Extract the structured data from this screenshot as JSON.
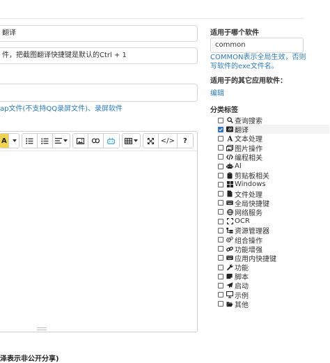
{
  "form": {
    "field1_value": "翻译",
    "field2_value": "件，把截图翻译快捷键是默认的Ctrl + 1",
    "field3_value": "",
    "links_prefix": "ap文件(不支持QQ录屏文件)、",
    "links_record": "录屏软件",
    "bottom_note": "泽表示非公开分享)"
  },
  "toolbar": {
    "font_color_label": "A",
    "source_label": "</>",
    "help_label": "?"
  },
  "sidebar": {
    "app_label": "适用于哪个软件",
    "app_value": "common",
    "app_help": "COMMON表示全局生效，否则写软件的exe文件名。",
    "other_label": "适用于的其它应用软件：",
    "edit_link": "编辑",
    "category_label": "分类标签",
    "categories": [
      {
        "label": "查询搜索",
        "icon": "search-icon",
        "checked": false
      },
      {
        "label": "翻译",
        "icon": "translate-icon",
        "checked": true
      },
      {
        "label": "文本处理",
        "icon": "text-icon",
        "checked": false
      },
      {
        "label": "图片操作",
        "icon": "images-icon",
        "checked": false
      },
      {
        "label": "编程相关",
        "icon": "code-icon",
        "checked": false
      },
      {
        "label": "AI",
        "icon": "robot-icon",
        "checked": false
      },
      {
        "label": "剪贴板相关",
        "icon": "clipboard-icon",
        "checked": false
      },
      {
        "label": "Windows",
        "icon": "windows-icon",
        "checked": false
      },
      {
        "label": "文件处理",
        "icon": "file-icon",
        "checked": false
      },
      {
        "label": "全局快捷键",
        "icon": "keyboard-icon",
        "checked": false
      },
      {
        "label": "网络服务",
        "icon": "globe-icon",
        "checked": false
      },
      {
        "label": "OCR",
        "icon": "scan-icon",
        "checked": false
      },
      {
        "label": "资源管理器",
        "icon": "folder-tree-icon",
        "checked": false
      },
      {
        "label": "组合操作",
        "icon": "cogs-icon",
        "checked": false
      },
      {
        "label": "功能增强",
        "icon": "link-icon",
        "checked": false
      },
      {
        "label": "应用内快捷键",
        "icon": "keyboard-icon",
        "checked": false
      },
      {
        "label": "功能",
        "icon": "wrench-icon",
        "checked": false
      },
      {
        "label": "脚本",
        "icon": "scroll-icon",
        "checked": false
      },
      {
        "label": "启动",
        "icon": "paper-plane-icon",
        "checked": false
      },
      {
        "label": "示例",
        "icon": "monitor-icon",
        "checked": false
      },
      {
        "label": "其他",
        "icon": "folder-open-icon",
        "checked": false
      }
    ]
  },
  "colors": {
    "link": "#2a7bbd",
    "checkbox_checked": "#2f6fd1",
    "font_color_button": "#f0d34e"
  }
}
